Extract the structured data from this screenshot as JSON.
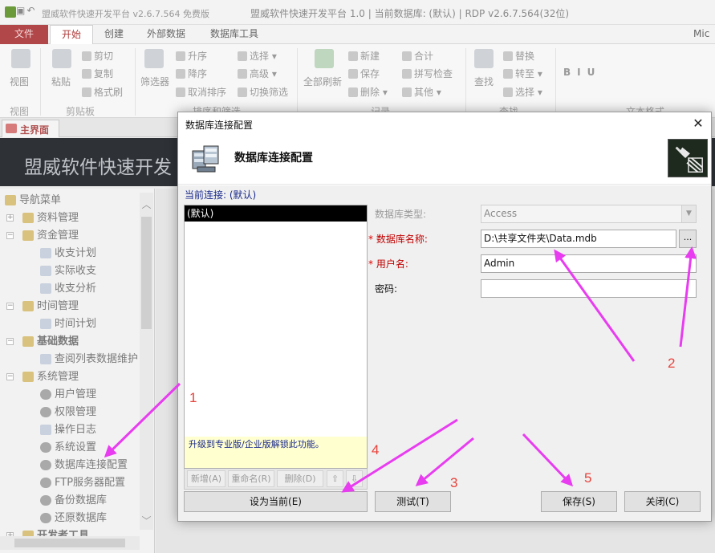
{
  "app": {
    "title_left": "盟威软件快速开发平台 v2.6.7.564 免费版",
    "window_title": "盟威软件快速开发平台 1.0 | 当前数据库: (默认) | RDP v2.6.7.564(32位)"
  },
  "menubar": {
    "file": "文件",
    "home": "开始",
    "create": "创建",
    "external_data": "外部数据",
    "db_tools": "数据库工具",
    "mic": "Mic"
  },
  "ribbon": {
    "view": "视图",
    "paste": "粘贴",
    "cut": "剪切",
    "copy": "复制",
    "format_painter": "格式刷",
    "filter": "筛选器",
    "asc": "升序",
    "desc": "降序",
    "remove_sort": "取消排序",
    "select": "选择",
    "advanced": "高级",
    "toggle_filter": "切换筛选",
    "refresh_all": "全部刷新",
    "new": "新建",
    "save": "保存",
    "delete": "删除",
    "sum": "合计",
    "spelling": "拼写检查",
    "other": "其他",
    "find": "查找",
    "replace": "替换",
    "goto": "转至",
    "select2": "选择",
    "group_view": "视图",
    "group_clipboard": "剪贴板",
    "group_sort": "排序和筛选",
    "group_records": "记录",
    "group_find": "查找",
    "group_text": "文本格式"
  },
  "doc_tab": {
    "label": "主界面"
  },
  "banner": {
    "text": "盟威软件快速开发"
  },
  "nav": {
    "items": [
      {
        "label": "导航菜单",
        "level": 0,
        "icon": "folder"
      },
      {
        "label": "资料管理",
        "level": 1,
        "icon": "folder"
      },
      {
        "label": "资金管理",
        "level": 1,
        "icon": "folder"
      },
      {
        "label": "收支计划",
        "level": 2,
        "icon": "doc"
      },
      {
        "label": "实际收支",
        "level": 2,
        "icon": "doc"
      },
      {
        "label": "收支分析",
        "level": 2,
        "icon": "doc"
      },
      {
        "label": "时间管理",
        "level": 1,
        "icon": "folder"
      },
      {
        "label": "时间计划",
        "level": 2,
        "icon": "doc"
      },
      {
        "label": "基础数据",
        "level": 1,
        "icon": "folder"
      },
      {
        "label": "查阅列表数据维护",
        "level": 2,
        "icon": "doc"
      },
      {
        "label": "系统管理",
        "level": 1,
        "icon": "folder"
      },
      {
        "label": "用户管理",
        "level": 2,
        "icon": "gear"
      },
      {
        "label": "权限管理",
        "level": 2,
        "icon": "gear"
      },
      {
        "label": "操作日志",
        "level": 2,
        "icon": "doc"
      },
      {
        "label": "系统设置",
        "level": 2,
        "icon": "gear"
      },
      {
        "label": "数据库连接配置",
        "level": 2,
        "icon": "gear"
      },
      {
        "label": "FTP服务器配置",
        "level": 2,
        "icon": "gear"
      },
      {
        "label": "备份数据库",
        "level": 2,
        "icon": "gear"
      },
      {
        "label": "还原数据库",
        "level": 2,
        "icon": "gear"
      },
      {
        "label": "开发者工具",
        "level": 1,
        "icon": "folder"
      }
    ]
  },
  "dialog": {
    "title": "数据库连接配置",
    "header_title": "数据库连接配置",
    "current_connection": "当前连接: (默认)",
    "connections": [
      "(默认)"
    ],
    "upgrade_note": "升级到专业版/企业版解锁此功能。",
    "toolbar": {
      "new": "新增(A)",
      "rename": "重命名(R)",
      "delete": "删除(D)",
      "up": "⇧",
      "down": "⇩"
    },
    "fields": {
      "db_type_label": "数据库类型:",
      "db_type_value": "Access",
      "db_name_label": "数据库名称:",
      "db_name_value": "D:\\共享文件夹\\Data.mdb",
      "username_label": "用户名:",
      "username_value": "Admin",
      "password_label": "密码:",
      "password_value": "",
      "browse": "..."
    },
    "buttons": {
      "set_current": "设为当前(E)",
      "test": "测试(T)",
      "save": "保存(S)",
      "close": "关闭(C)"
    }
  },
  "annotations": {
    "labels": [
      "1",
      "2",
      "3",
      "4",
      "5"
    ],
    "arrow_color": "#e83cf0",
    "number_color": "#e8413a"
  }
}
